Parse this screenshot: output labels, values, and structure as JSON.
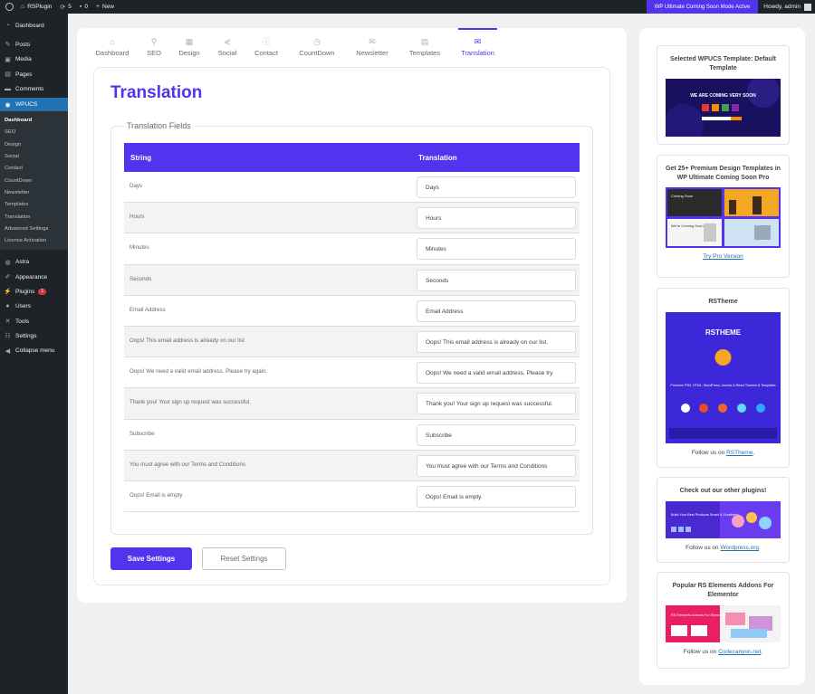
{
  "admin_bar": {
    "site_name": "RSPlugin",
    "updates_count": "5",
    "comments_count": "0",
    "new_label": "New",
    "notice": "WP Ultimate Coming Soon Mode Active",
    "howdy": "Howdy, admin"
  },
  "sidebar": {
    "top_items": [
      {
        "label": "Dashboard",
        "icon": "dashboard-icon"
      },
      {
        "label": "Posts",
        "icon": "pin-icon"
      },
      {
        "label": "Media",
        "icon": "media-icon"
      },
      {
        "label": "Pages",
        "icon": "pages-icon"
      },
      {
        "label": "Comments",
        "icon": "comments-icon"
      }
    ],
    "current": {
      "label": "WPUCS",
      "icon": "wpucs-icon"
    },
    "submenu": [
      "Dashboard",
      "SEO",
      "Design",
      "Social",
      "Contact",
      "CountDown",
      "Newsletter",
      "Templates",
      "Translation",
      "Advanced Settings",
      "License Activation"
    ],
    "bottom_items": [
      {
        "label": "Astra",
        "icon": "astra-icon"
      },
      {
        "label": "Appearance",
        "icon": "brush-icon"
      },
      {
        "label": "Plugins",
        "icon": "plugin-icon",
        "badge": "1"
      },
      {
        "label": "Users",
        "icon": "user-icon"
      },
      {
        "label": "Tools",
        "icon": "wrench-icon"
      },
      {
        "label": "Settings",
        "icon": "settings-icon"
      },
      {
        "label": "Collapse menu",
        "icon": "collapse-icon"
      }
    ]
  },
  "tabs": [
    {
      "label": "Dashboard",
      "icon": "home-icon"
    },
    {
      "label": "SEO",
      "icon": "seo-icon"
    },
    {
      "label": "Design",
      "icon": "design-icon"
    },
    {
      "label": "Social",
      "icon": "share-icon"
    },
    {
      "label": "Contact",
      "icon": "info-icon"
    },
    {
      "label": "CountDown",
      "icon": "clock-icon"
    },
    {
      "label": "Newsletter",
      "icon": "mail-icon"
    },
    {
      "label": "Templates",
      "icon": "templates-icon"
    },
    {
      "label": "Translation",
      "icon": "envelope-icon",
      "active": true
    }
  ],
  "page": {
    "title": "Translation",
    "fieldset_legend": "Translation Fields",
    "col_string": "String",
    "col_translation": "Translation",
    "rows": [
      {
        "string": "Days",
        "translation": "Days"
      },
      {
        "string": "Hours",
        "translation": "Hours"
      },
      {
        "string": "Minutes",
        "translation": "Minutes"
      },
      {
        "string": "Seconds",
        "translation": "Seconds"
      },
      {
        "string": "Email Address",
        "translation": "Email Address"
      },
      {
        "string": "Oops! This email address is already on our list",
        "translation": "Oops! This email address is already on our list."
      },
      {
        "string": "Oops! We need a valid email address. Please try again.",
        "translation": "Oops! We need a valid email address. Please try"
      },
      {
        "string": "Thank you! Your sign up request was successful.",
        "translation": "Thank you! Your sign up request was successful."
      },
      {
        "string": "Subscribe",
        "translation": "Subscribe"
      },
      {
        "string": "You must agree with our Terms and Conditions",
        "translation": "You must agree with our Terms and Conditions"
      },
      {
        "string": "Oops! Email is empty",
        "translation": "Oops! Email is empty."
      }
    ],
    "save_label": "Save Settings",
    "reset_label": "Reset Settings"
  },
  "right_panel": {
    "w1_title": "Selected WPUCS Template: Default Template",
    "w1_img_text": "WE ARE COMING VERY SOON",
    "w2_title": "Get 25+ Premium Design Templates in WP Ultimate Coming Soon Pro",
    "w2_img_texts": [
      "Coming Soon",
      "We're Coming Soon"
    ],
    "w2_link": "Try Pro Version",
    "w3_title": "RSTheme",
    "w3_img_brand": "RSTHEME",
    "w3_img_line": "Premium PSD, HTML, WordPress, Joomla & React Themes & Templates",
    "w3_follow": "Follow us on",
    "w3_link": "RSTheme",
    "w4_title": "Check out our other plugins!",
    "w4_img_text": "Build Your Best Products Smart & Creatively",
    "w4_follow": "Follow us on",
    "w4_link": "Wordpress.org",
    "w5_title": "Popular RS Elements Addons For Elementor",
    "w5_img_text": "RS Elements Addons For Elementor",
    "w5_follow": "Follow us on",
    "w5_link": "Codecanyon.net"
  },
  "colors": {
    "accent": "#5333ed",
    "admin_bar": "#1d2327",
    "menu_current": "#2271b1",
    "background": "#f0f0f1"
  }
}
